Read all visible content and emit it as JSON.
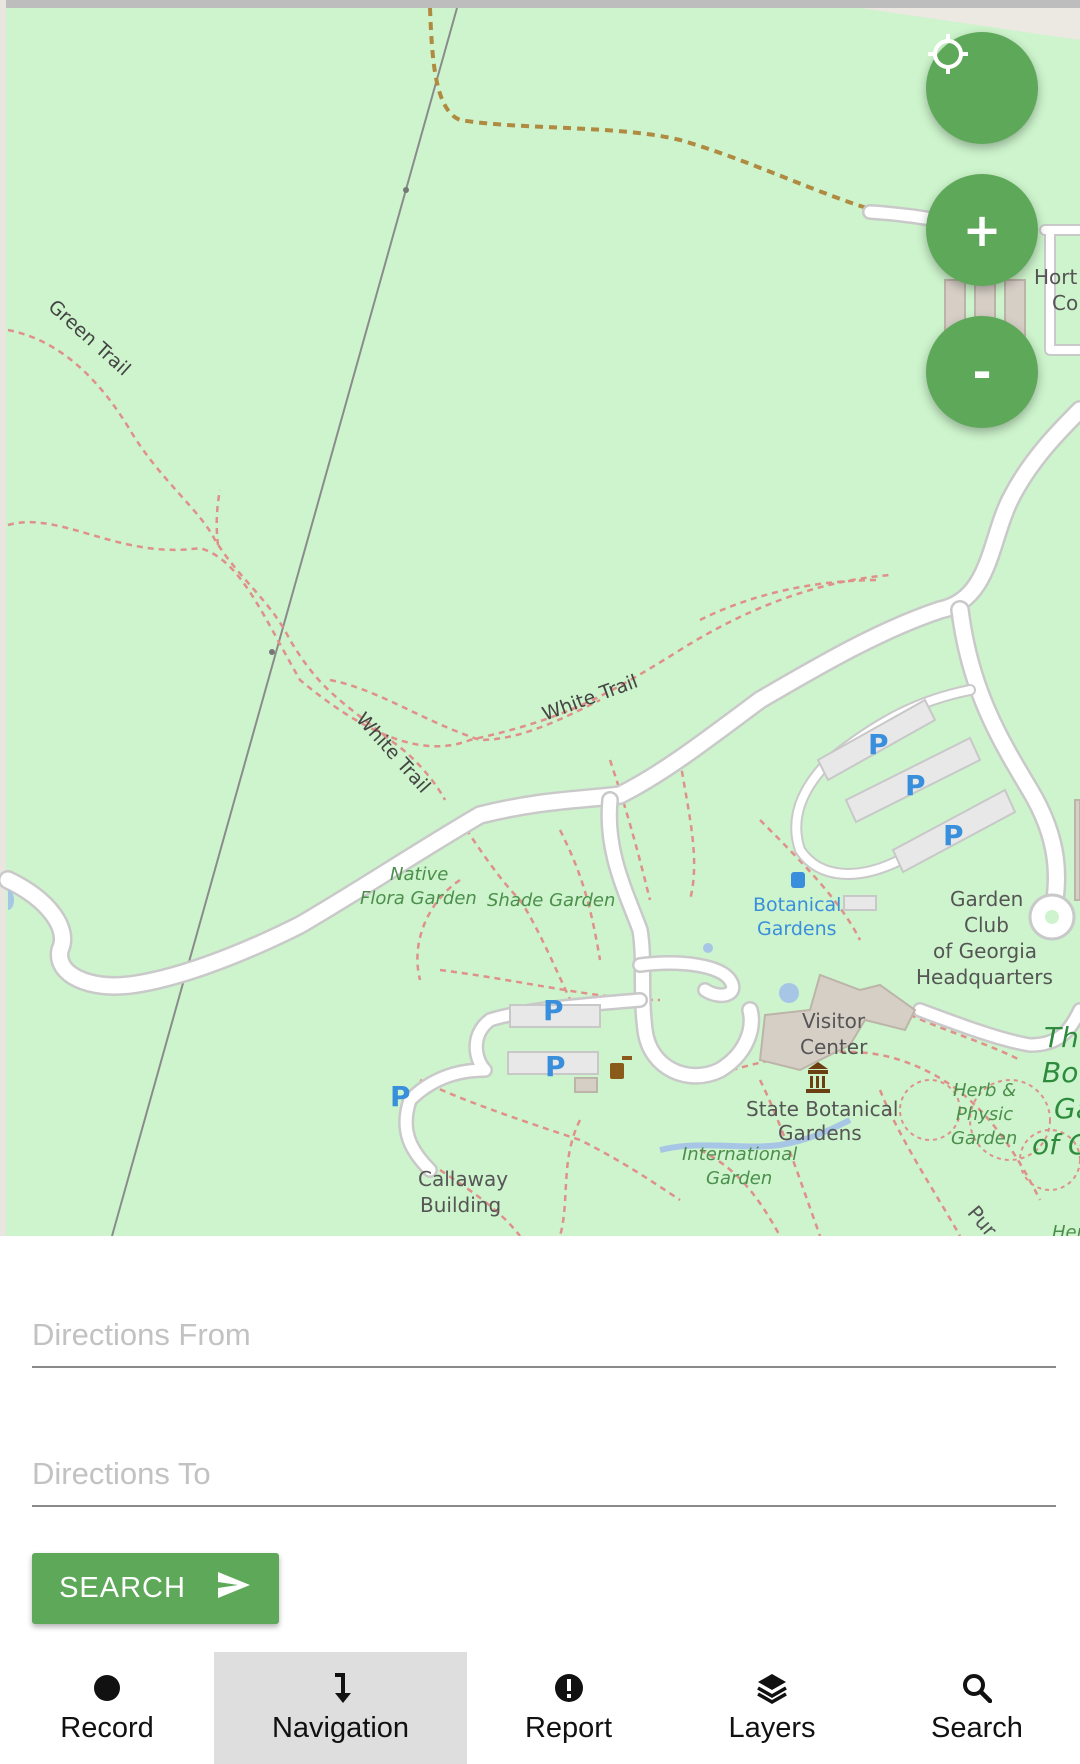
{
  "map": {
    "labels": {
      "green_trail": "Green Trail",
      "white_trail_1": "White Trail",
      "white_trail_2": "White Trail",
      "native_flora_1": "Native",
      "native_flora_2": "Flora Garden",
      "shade_garden": "Shade Garden",
      "botanical_1": "Botanical",
      "botanical_2": "Gardens",
      "garden_club": "Garden",
      "garden_club_2": "Club",
      "garden_club_3": "of Georgia",
      "garden_club_4": "Headquarters",
      "visitor_1": "Visitor",
      "visitor_2": "Center",
      "state_1": "State Botanical",
      "state_2": "Gardens",
      "intl_1": "International",
      "intl_2": "Garden",
      "callaway_1": "Callaway",
      "callaway_2": "Building",
      "herb_1": "Herb &",
      "herb_2": "Physic",
      "herb_3": "Garden",
      "hort_1": "Hort",
      "hort_2": "Co",
      "the_bot_1": "The",
      "the_bot_2": "Bot",
      "the_bot_3": "Ga",
      "the_bot_4": "of G",
      "pur": "Pur",
      "her": "Her",
      "parking": "P"
    }
  },
  "controls": {
    "locate_icon": "crosshair-icon",
    "zoom_in": "+",
    "zoom_out": "-"
  },
  "form": {
    "from_placeholder": "Directions From",
    "to_placeholder": "Directions To",
    "search_label": "SEARCH",
    "search_icon": "send-icon"
  },
  "bottom_nav": {
    "items": [
      {
        "label": "Record",
        "icon": "record-dot-icon"
      },
      {
        "label": "Navigation",
        "icon": "direction-arrow-icon"
      },
      {
        "label": "Report",
        "icon": "alert-circle-icon"
      },
      {
        "label": "Layers",
        "icon": "layers-icon"
      },
      {
        "label": "Search",
        "icon": "magnifier-icon"
      }
    ],
    "active": "Navigation"
  },
  "colors": {
    "accent": "#5ea85a",
    "map_bg": "#cdf4cc",
    "trail": "#e0908a",
    "path_brown": "#b08a40",
    "nav_active_bg": "#dedede"
  }
}
